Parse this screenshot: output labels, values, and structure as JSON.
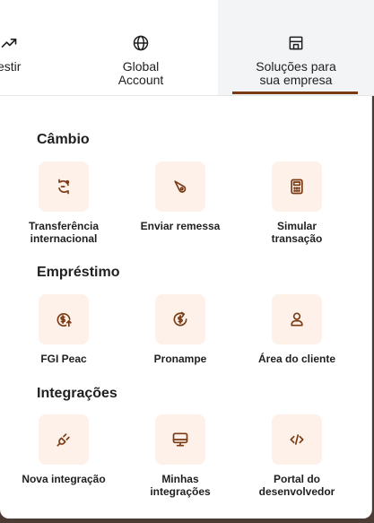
{
  "nav": {
    "items": [
      {
        "label": "vestir",
        "icon": "trending-up-icon"
      },
      {
        "label": "Global\nAccount",
        "icon": "globe-icon"
      },
      {
        "label": "Soluções para\nsua empresa",
        "icon": "store-icon",
        "active": true
      }
    ]
  },
  "colors": {
    "accent": "#7a3a14",
    "tile_bg": "#fdf1e9",
    "active_tab_bg": "#f3f4f6"
  },
  "sections": [
    {
      "title": "Câmbio",
      "items": [
        {
          "label": "Transferência\ninternacional",
          "icon": "exchange-arrows-icon"
        },
        {
          "label": "Enviar remessa",
          "icon": "send-remittance-icon"
        },
        {
          "label": "Simular\ntransação",
          "icon": "calculator-icon"
        }
      ]
    },
    {
      "title": "Empréstimo",
      "items": [
        {
          "label": "FGI Peac",
          "icon": "coin-arrow-up-icon"
        },
        {
          "label": "Pronampe",
          "icon": "coin-refresh-icon"
        },
        {
          "label": "Área do cliente",
          "icon": "user-icon"
        }
      ]
    },
    {
      "title": "Integrações",
      "items": [
        {
          "label": "Nova integração",
          "icon": "plug-icon"
        },
        {
          "label": "Minhas\nintegrações",
          "icon": "monitor-icon"
        },
        {
          "label": "Portal do\ndesenvolvedor",
          "icon": "code-icon"
        }
      ]
    }
  ]
}
